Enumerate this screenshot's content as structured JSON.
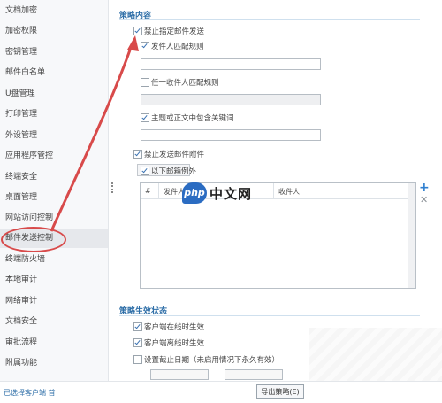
{
  "sidebar": {
    "items": [
      {
        "label": "文档加密"
      },
      {
        "label": "加密权限"
      },
      {
        "label": "密钥管理"
      },
      {
        "label": "邮件白名单"
      },
      {
        "label": "U盘管理"
      },
      {
        "label": "打印管理"
      },
      {
        "label": "外设管理"
      },
      {
        "label": "应用程序管控"
      },
      {
        "label": "终端安全"
      },
      {
        "label": "桌面管理"
      },
      {
        "label": "网站访问控制"
      },
      {
        "label": "邮件发送控制"
      },
      {
        "label": "终端防火墙"
      },
      {
        "label": "本地审计"
      },
      {
        "label": "网络审计"
      },
      {
        "label": "文档安全"
      },
      {
        "label": "审批流程"
      },
      {
        "label": "附属功能"
      }
    ],
    "active_index": 11
  },
  "policy": {
    "title": "策略内容",
    "forbid_specific": "禁止指定邮件发送",
    "sender_match": "发件人匹配规则",
    "any_recipient": "任一收件人匹配规则",
    "subject_keyword": "主题或正文中包含关键词",
    "forbid_attachment": "禁止发送邮件附件",
    "except_following": "以下邮箱例外",
    "table_headers": [
      "#",
      "发件人",
      "收件人"
    ]
  },
  "effect": {
    "title": "策略生效状态",
    "online": "客户端在线时生效",
    "offline": "客户端离线时生效",
    "expire": "设置截止日期（未启用情况下永久有效）"
  },
  "footer": {
    "selected_clients": "已选择客户端 首",
    "export": "导出策略(E)"
  },
  "watermark": {
    "badge": "php",
    "text": "中文网"
  },
  "colors": {
    "accent": "#2f6fa8",
    "highlight": "#d84a4a",
    "sidebar_bg": "#f7f8fa"
  },
  "icons": {
    "add": "plus-icon",
    "remove": "close-icon"
  }
}
